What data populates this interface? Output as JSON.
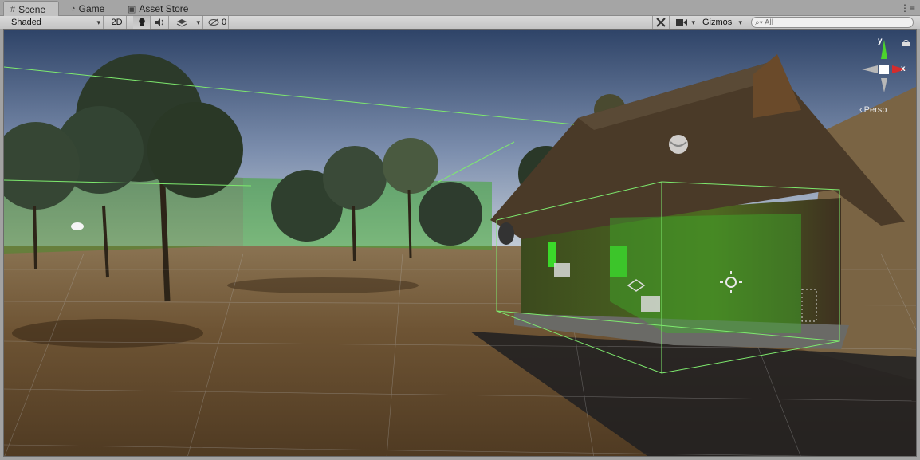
{
  "tabs": [
    {
      "label": "Scene",
      "icon": "scene-grid-icon",
      "active": true
    },
    {
      "label": "Game",
      "icon": "game-pacman-icon",
      "active": false
    },
    {
      "label": "Asset Store",
      "icon": "store-bag-icon",
      "active": false
    }
  ],
  "toolbar": {
    "draw_mode": "Shaded",
    "mode_2d": "2D",
    "hidden_count": "0",
    "gizmos": "Gizmos",
    "search_placeholder": "All"
  },
  "gizmo": {
    "y_label": "y",
    "x_label": "x",
    "projection": "Persp"
  },
  "colors": {
    "toolbar_bg": "#c4c4c4",
    "sky_top": "#344a70",
    "ground": "#6b5232",
    "gizmo_y": "#4cd42c",
    "gizmo_x": "#d42c2c",
    "bounds_line": "#7eea6e"
  }
}
